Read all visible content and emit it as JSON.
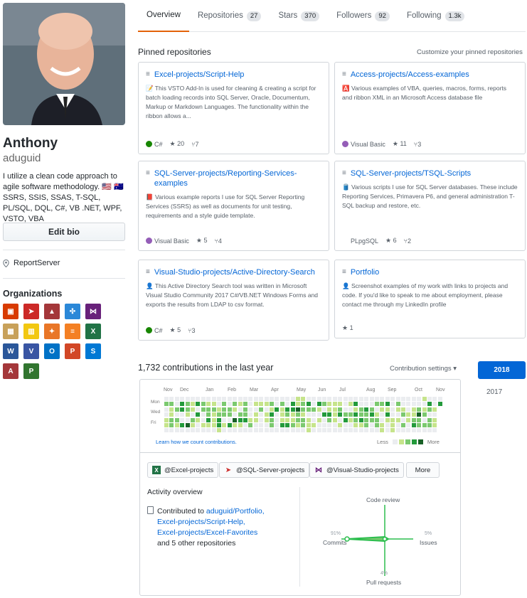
{
  "profile": {
    "name": "Anthony",
    "login": "aduguid",
    "bio": "I utilize a clean code approach to agile software methodology. 🇺🇸 🇦🇺 SSRS, SSIS, SSAS, T-SQL, PL/SQL, DQL, C#, VB .NET, WPF, VSTO, VBA",
    "edit_bio_label": "Edit bio",
    "location": "ReportServer",
    "organizations_title": "Organizations",
    "org_icons": [
      "office",
      "sql-server",
      "access",
      "cluster",
      "visual-studio",
      "package",
      "power-bi",
      "tableau",
      "stack-overflow",
      "excel",
      "word",
      "visio",
      "outlook",
      "powerpoint",
      "sharepoint",
      "access-2",
      "project"
    ]
  },
  "tabs": [
    {
      "label": "Overview",
      "count": ""
    },
    {
      "label": "Repositories",
      "count": "27"
    },
    {
      "label": "Stars",
      "count": "370"
    },
    {
      "label": "Followers",
      "count": "92"
    },
    {
      "label": "Following",
      "count": "1.3k"
    }
  ],
  "pinned": {
    "title": "Pinned repositories",
    "customize": "Customize your pinned repositories",
    "repos": [
      {
        "name": "Excel-projects/Script-Help",
        "desc": "📝 This VSTO Add-In is used for cleaning & creating a script for batch loading records into SQL Server, Oracle, Documentum, Markup or Markdown Languages. The functionality within the ribbon allows a...",
        "lang": "C#",
        "lang_color": "#178600",
        "stars": "20",
        "forks": "7"
      },
      {
        "name": "Access-projects/Access-examples",
        "desc": "🅰️ Various examples of VBA, queries, macros, forms, reports and ribbon XML in an Microsoft Access database file",
        "lang": "Visual Basic",
        "lang_color": "#945db7",
        "stars": "11",
        "forks": "3"
      },
      {
        "name": "SQL-Server-projects/Reporting-Services-examples",
        "desc": "📕 Various example reports I use for SQL Server Reporting Services (SSRS) as well as documents for unit testing, requirements and a style guide template.",
        "lang": "Visual Basic",
        "lang_color": "#945db7",
        "stars": "5",
        "forks": "4"
      },
      {
        "name": "SQL-Server-projects/TSQL-Scripts",
        "desc": "🛢️ Various scripts I use for SQL Server databases. These include Reporting Services, Primavera P6, and general administration T-SQL backup and restore, etc.",
        "lang": "PLpgSQL",
        "lang_color": "",
        "stars": "6",
        "forks": "2"
      },
      {
        "name": "Visual-Studio-projects/Active-Directory-Search",
        "desc": "👤 This Active Directory Search tool was written in Microsoft Visual Studio Community 2017 C#/VB.NET Windows Forms and exports the results from LDAP to csv format.",
        "lang": "C#",
        "lang_color": "#178600",
        "stars": "5",
        "forks": "3"
      },
      {
        "name": "Portfolio",
        "desc": "👤 Screenshot examples of my work with links to projects and code. If you'd like to speak to me about employment, please contact me through my LinkedIn profile",
        "lang": "",
        "lang_color": "",
        "stars": "1",
        "forks": ""
      }
    ]
  },
  "contributions": {
    "title": "1,732 contributions in the last year",
    "settings": "Contribution settings ▾",
    "years": [
      "2018",
      "2017"
    ],
    "months": [
      "Nov",
      "Dec",
      "Jan",
      "Feb",
      "Mar",
      "Apr",
      "May",
      "Jun",
      "Jul",
      "Aug",
      "Sep",
      "Oct",
      "Nov"
    ],
    "days": [
      "Mon",
      "Wed",
      "Fri"
    ],
    "learn": "Learn how we count contributions.",
    "less": "Less",
    "more": "More",
    "colors": [
      "#ebedf0",
      "#c6e48b",
      "#7bc96f",
      "#239a3b",
      "#196127"
    ]
  },
  "activity": {
    "chips": [
      "@Excel-projects",
      "@SQL-Server-projects",
      "@Visual-Studio-projects"
    ],
    "more_label": "More",
    "overview_title": "Activity overview",
    "contributed_to": "Contributed to",
    "repos": [
      "aduguid/Portfolio,",
      "Excel-projects/Script-Help,",
      "Excel-projects/Excel-Favorites"
    ],
    "other": "and 5 other repositories",
    "axes": {
      "top": "Code review",
      "left": "Commits",
      "right": "Issues",
      "bottom": "Pull requests"
    },
    "pcts": {
      "commits": "91%",
      "issues": "5%",
      "pull_requests": "4%"
    }
  }
}
